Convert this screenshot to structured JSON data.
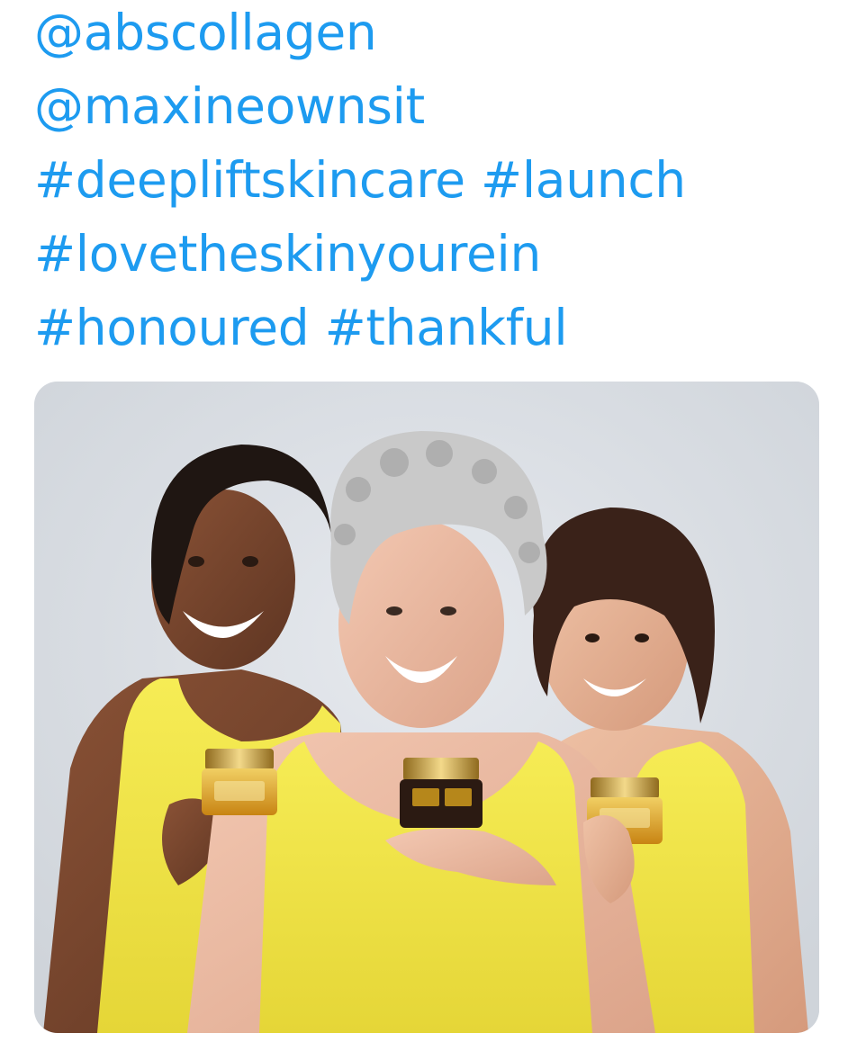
{
  "tweet": {
    "mentions": [
      "@abscollagen",
      "@maxineownsit"
    ],
    "hashtag_lines": [
      [
        "#deepliftskincare",
        "#launch"
      ],
      [
        "#lovetheskinyourein"
      ],
      [
        "#honoured",
        "#thankful"
      ]
    ]
  },
  "media": {
    "colors": {
      "background": "#dce0e6",
      "link": "#1d9bf0",
      "top": "#f2e64a",
      "jar_gold": "#d9a21e",
      "jar_dark": "#2b1a12"
    }
  }
}
